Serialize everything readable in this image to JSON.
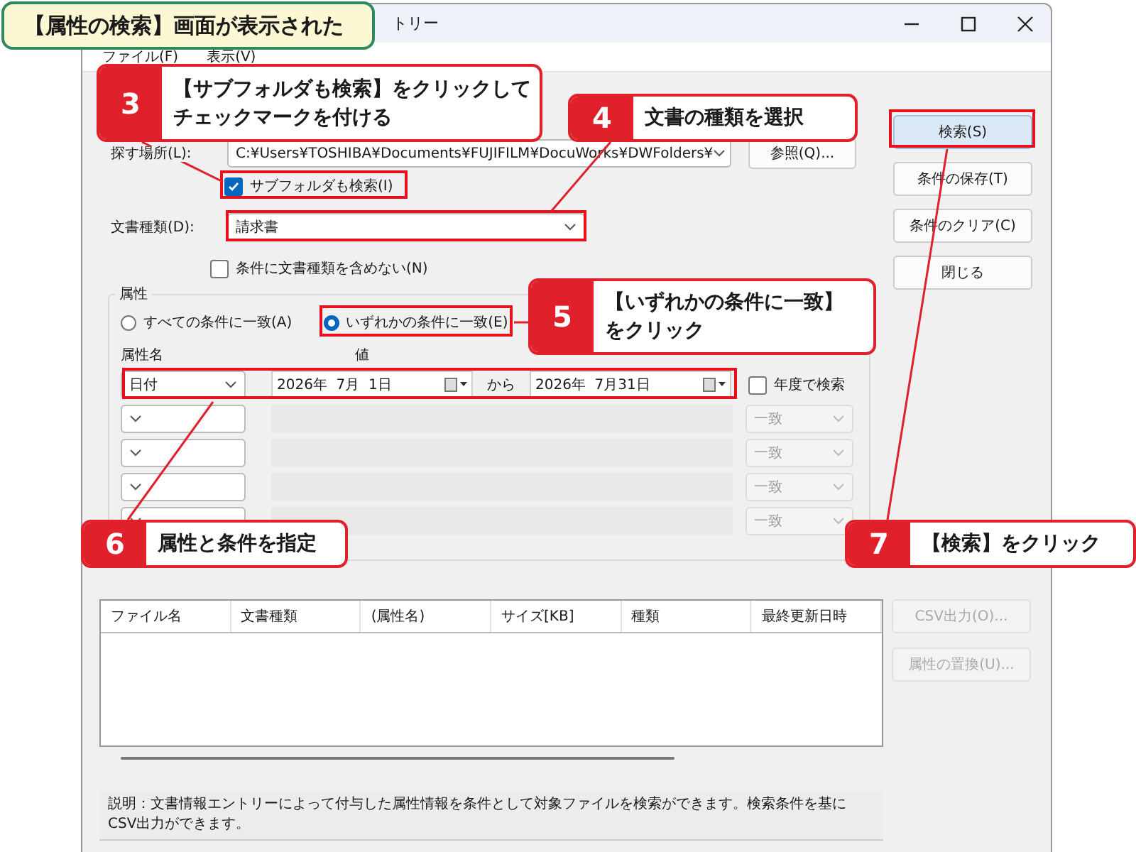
{
  "banner": {
    "text": "【属性の検索】画面が表示された"
  },
  "window": {
    "title": "トリー",
    "menu": [
      "ファイル(F)",
      "表示(V)"
    ]
  },
  "search_location": {
    "label": "探す場所(L):",
    "value": "C:¥Users¥TOSHIBA¥Documents¥FUJIFILM¥DocuWorks¥DWFolders¥",
    "browse_button": "参照(Q)..."
  },
  "include_subfolders": {
    "label": "サブフォルダも検索(I)",
    "checked": true
  },
  "document_type": {
    "label": "文書種類(D):",
    "value": "請求書"
  },
  "exclude_type": {
    "label": "条件に文書種類を含めない(N)",
    "checked": false
  },
  "attributes": {
    "title": "属性",
    "match_options": [
      {
        "label": "すべての条件に一致(A)",
        "selected": false
      },
      {
        "label": "いずれかの条件に一致(E)",
        "selected": true
      }
    ],
    "column_headers": [
      "属性名",
      "値"
    ],
    "date_row": {
      "attribute": "日付",
      "from": "2026年  7月  1日",
      "between": "から",
      "to": "2026年  7月31日",
      "fiscal_year": {
        "label": "年度で検索",
        "checked": false
      }
    },
    "empty_rows": [
      {
        "match": "一致"
      },
      {
        "match": "一致"
      },
      {
        "match": "一致"
      },
      {
        "match": "一致"
      }
    ]
  },
  "buttons": [
    {
      "label": "検索(S)",
      "default": true,
      "disabled": false
    },
    {
      "label": "条件の保存(T)",
      "default": false,
      "disabled": false
    },
    {
      "label": "条件のクリア(C)",
      "default": false,
      "disabled": false
    },
    {
      "label": "閉じる",
      "default": false,
      "disabled": false
    }
  ],
  "results": {
    "columns": [
      "ファイル名",
      "文書種類",
      "(属性名)",
      "サイズ[KB]",
      "種類",
      "最終更新日時"
    ],
    "buttons": [
      {
        "label": "CSV出力(O)...",
        "disabled": true
      },
      {
        "label": "属性の置換(U)...",
        "disabled": true
      }
    ]
  },
  "description": "説明：文書情報エントリーによって付与した属性情報を条件として対象ファイルを検索ができます。検索条件を基にCSV出力ができます。",
  "callouts": [
    {
      "number": "3",
      "lines": [
        "【サブフォルダも検索】をクリックして",
        "チェックマークを付ける"
      ]
    },
    {
      "number": "4",
      "lines": [
        "文書の種類を選択"
      ]
    },
    {
      "number": "5",
      "lines": [
        "【いずれかの条件に一致】",
        "をクリック"
      ]
    },
    {
      "number": "6",
      "lines": [
        "属性と条件を指定"
      ]
    },
    {
      "number": "7",
      "lines": [
        "【検索】をクリック"
      ]
    }
  ]
}
